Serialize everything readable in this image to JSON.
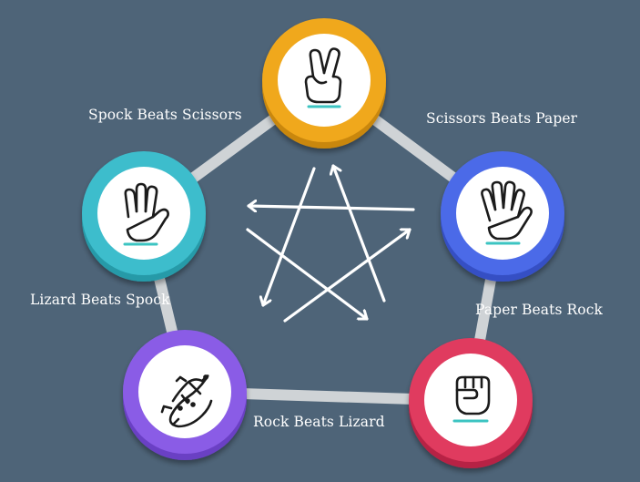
{
  "colors": {
    "background": "#4e6478",
    "connector": "#cfd3d6",
    "arrows": "#ffffff",
    "accent_line": "#3cc4c2"
  },
  "nodes": [
    {
      "id": "scissors",
      "icon": "scissors-hand-icon",
      "ring_color": "#f0a81e",
      "ring_shade": "#c98710"
    },
    {
      "id": "paper",
      "icon": "paper-hand-icon",
      "ring_color": "#4c6ae8",
      "ring_shade": "#3550c4"
    },
    {
      "id": "rock",
      "icon": "rock-fist-icon",
      "ring_color": "#e03a5e",
      "ring_shade": "#b72344"
    },
    {
      "id": "lizard",
      "icon": "lizard-icon",
      "ring_color": "#8a5be6",
      "ring_shade": "#6b3fc4"
    },
    {
      "id": "spock",
      "icon": "spock-hand-icon",
      "ring_color": "#3dbdcc",
      "ring_shade": "#279aa8"
    }
  ],
  "labels": {
    "spock_scissors": "Spock Beats Scissors",
    "scissors_paper": "Scissors Beats Paper",
    "lizard_spock": "Lizard Beats Spock",
    "paper_rock": "Paper Beats Rock",
    "rock_lizard": "Rock Beats Lizard"
  }
}
